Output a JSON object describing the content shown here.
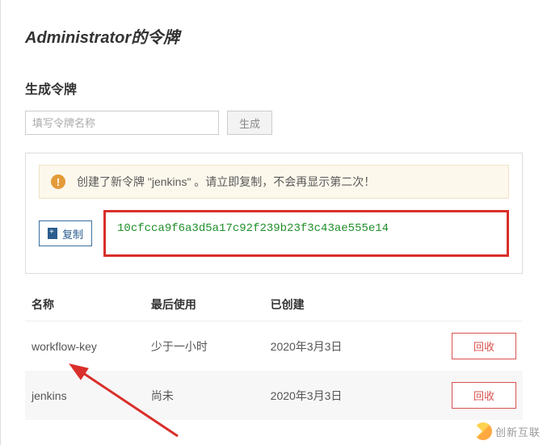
{
  "page": {
    "title_prefix": "Administrator",
    "title_suffix": "的令牌"
  },
  "generate": {
    "section_title": "生成令牌",
    "placeholder": "填写令牌名称",
    "button_label": "生成"
  },
  "alert": {
    "icon_glyph": "!",
    "message": "创建了新令牌 \"jenkins\" 。请立即复制，不会再显示第二次！"
  },
  "token": {
    "copy_label": "复制",
    "value": "10cfcca9f6a3d5a17c92f239b23f3c43ae555e14"
  },
  "table": {
    "headers": {
      "name": "名称",
      "last_used": "最后使用",
      "created": "已创建",
      "action": ""
    },
    "rows": [
      {
        "name": "workflow-key",
        "last_used": "少于一小时",
        "created": "2020年3月3日",
        "action": "回收"
      },
      {
        "name": "jenkins",
        "last_used": "尚未",
        "created": "2020年3月3日",
        "action": "回收"
      }
    ]
  },
  "watermark": {
    "text": "创新互联"
  }
}
